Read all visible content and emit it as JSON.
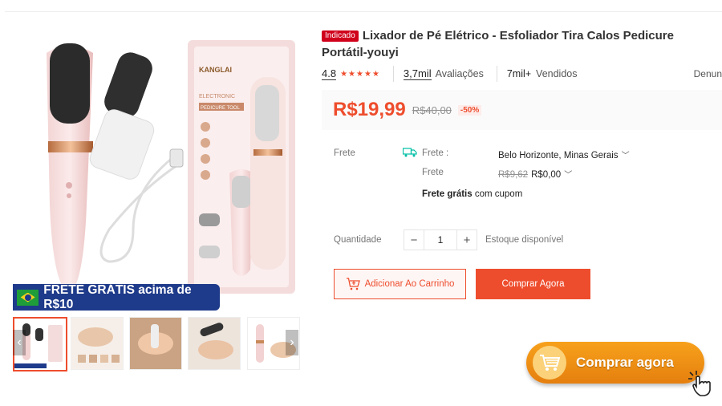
{
  "product": {
    "badge": "Indicado",
    "title": "Lixador de Pé Elétrico - Esfoliador Tira Calos Pedicure Portátil-youyi"
  },
  "gallery": {
    "banner_text": "FRETE GRÁTIS acima de R$10",
    "brand_on_box": "KANGLAI",
    "box_line1": "ELECTRONIC",
    "box_line2": "PEDICURE TOOL"
  },
  "stats": {
    "rating": "4.8",
    "stars": "★★★★★",
    "reviews_count": "3,7mil",
    "reviews_label": "Avaliações",
    "sold_count": "7mil+",
    "sold_label": "Vendidos",
    "report": "Denun"
  },
  "price": {
    "current": "R$19,99",
    "original": "R$40,00",
    "discount": "-50%"
  },
  "shipping": {
    "label": "Frete",
    "to_label": "Frete :",
    "destination": "Belo Horizonte, Minas Gerais",
    "cost_label": "Frete",
    "cost_original": "R$9,62",
    "cost_current": "R$0,00",
    "free_bold": "Frete grátis",
    "free_rest": "com cupom"
  },
  "quantity": {
    "label": "Quantidade",
    "minus": "−",
    "value": "1",
    "plus": "+",
    "stock": "Estoque disponível"
  },
  "actions": {
    "add_to_cart": "Adicionar Ao Carrinho",
    "buy_now": "Comprar Agora",
    "cta": "Comprar agora"
  },
  "colors": {
    "accent": "#ee4d2d",
    "cta": "#f39a17",
    "banner": "#1e3a8a"
  }
}
